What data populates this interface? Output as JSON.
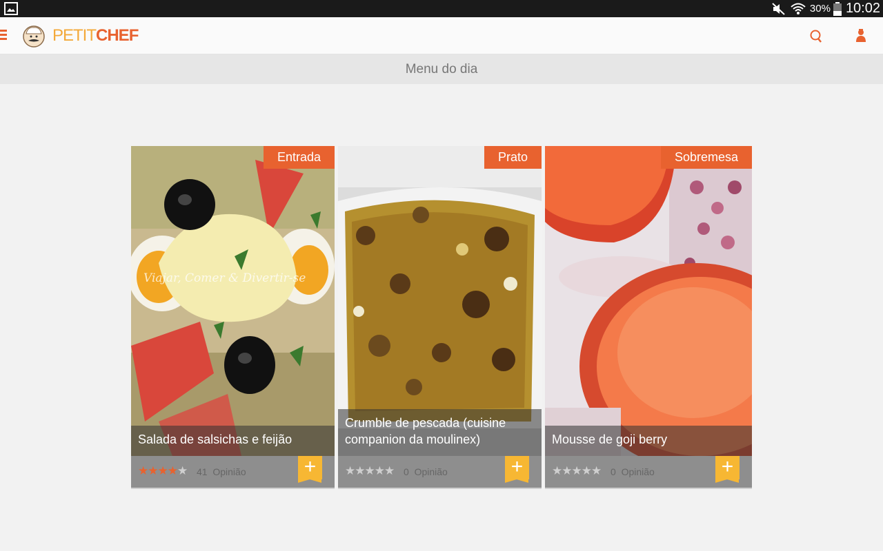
{
  "status_bar": {
    "battery": "30%",
    "time": "10:02"
  },
  "app_bar": {
    "logo_part1": "PETIT",
    "logo_part2": "CHEF"
  },
  "page": {
    "title": "Menu do dia"
  },
  "cards": [
    {
      "tag": "Entrada",
      "title": "Salada de salsichas e feijão",
      "rating": 4,
      "stars": "★★★★",
      "stars_off": "★",
      "reviews_count": "41",
      "reviews_label": "Opinião",
      "add_label": "+",
      "watermark": "Viajar, Comer & Divertir-se"
    },
    {
      "tag": "Prato",
      "title": "Crumble de pescada (cuisine companion da moulinex)",
      "rating": 0,
      "stars": "",
      "stars_off": "★★★★★",
      "reviews_count": "0",
      "reviews_label": "Opinião",
      "add_label": "+"
    },
    {
      "tag": "Sobremesa",
      "title": "Mousse de goji berry",
      "rating": 0,
      "stars": "",
      "stars_off": "★★★★★",
      "reviews_count": "0",
      "reviews_label": "Opinião",
      "add_label": "+"
    }
  ],
  "colors": {
    "accent": "#e8622f",
    "add_button": "#f7b733",
    "logo_light": "#f3a93a"
  }
}
